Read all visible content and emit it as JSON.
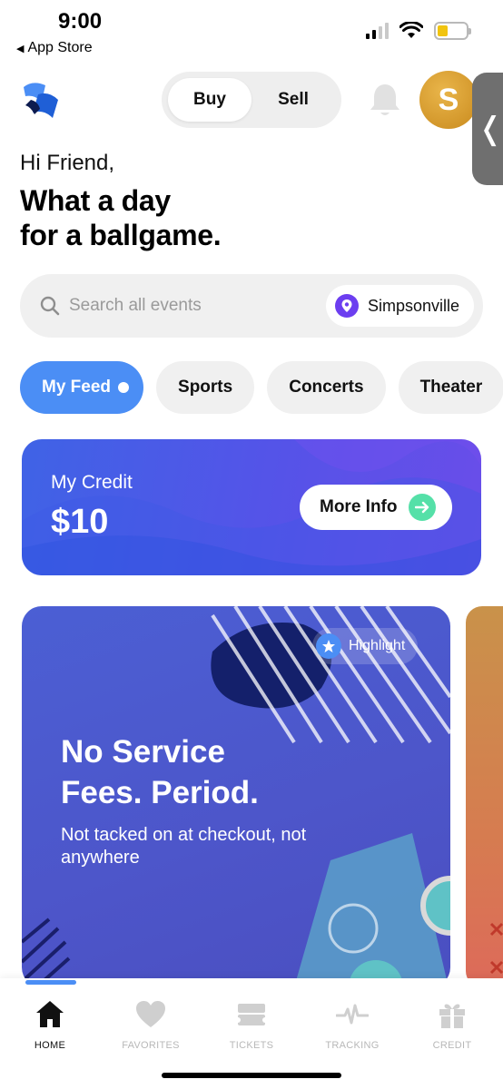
{
  "status_bar": {
    "time": "9:00",
    "back_label": "App Store"
  },
  "header": {
    "segments": [
      "Buy",
      "Sell"
    ],
    "active_segment": "Buy",
    "avatar_initial": "S",
    "side_handle_glyph": "❬"
  },
  "greeting": {
    "hello": "Hi Friend,",
    "headline_line1": "What a day",
    "headline_line2": "for a ballgame."
  },
  "search": {
    "placeholder": "Search all events",
    "location": "Simpsonville"
  },
  "chips": [
    {
      "label": "My Feed",
      "active": true
    },
    {
      "label": "Sports",
      "active": false
    },
    {
      "label": "Concerts",
      "active": false
    },
    {
      "label": "Theater",
      "active": false
    }
  ],
  "credit": {
    "label": "My Credit",
    "value": "$10",
    "button_label": "More Info"
  },
  "promo": {
    "badge": "Highlight",
    "title_line1": "No Service",
    "title_line2": "Fees. Period.",
    "subtitle": "Not tacked on at checkout, not anywhere"
  },
  "tabs": [
    {
      "label": "HOME",
      "icon": "home-icon",
      "active": true
    },
    {
      "label": "FAVORITES",
      "icon": "heart-icon",
      "active": false
    },
    {
      "label": "TICKETS",
      "icon": "tickets-icon",
      "active": false
    },
    {
      "label": "TRACKING",
      "icon": "pulse-icon",
      "active": false
    },
    {
      "label": "CREDIT",
      "icon": "gift-icon",
      "active": false
    }
  ],
  "colors": {
    "accent_blue": "#4b8ef5",
    "credit_gradient_start": "#3f63e6",
    "credit_gradient_end": "#6a4de9",
    "promo_bg": "#4b5fd4",
    "location_purple": "#6c3ef0",
    "arrow_green": "#55e0a8",
    "avatar_gold": "#d99a2b"
  }
}
